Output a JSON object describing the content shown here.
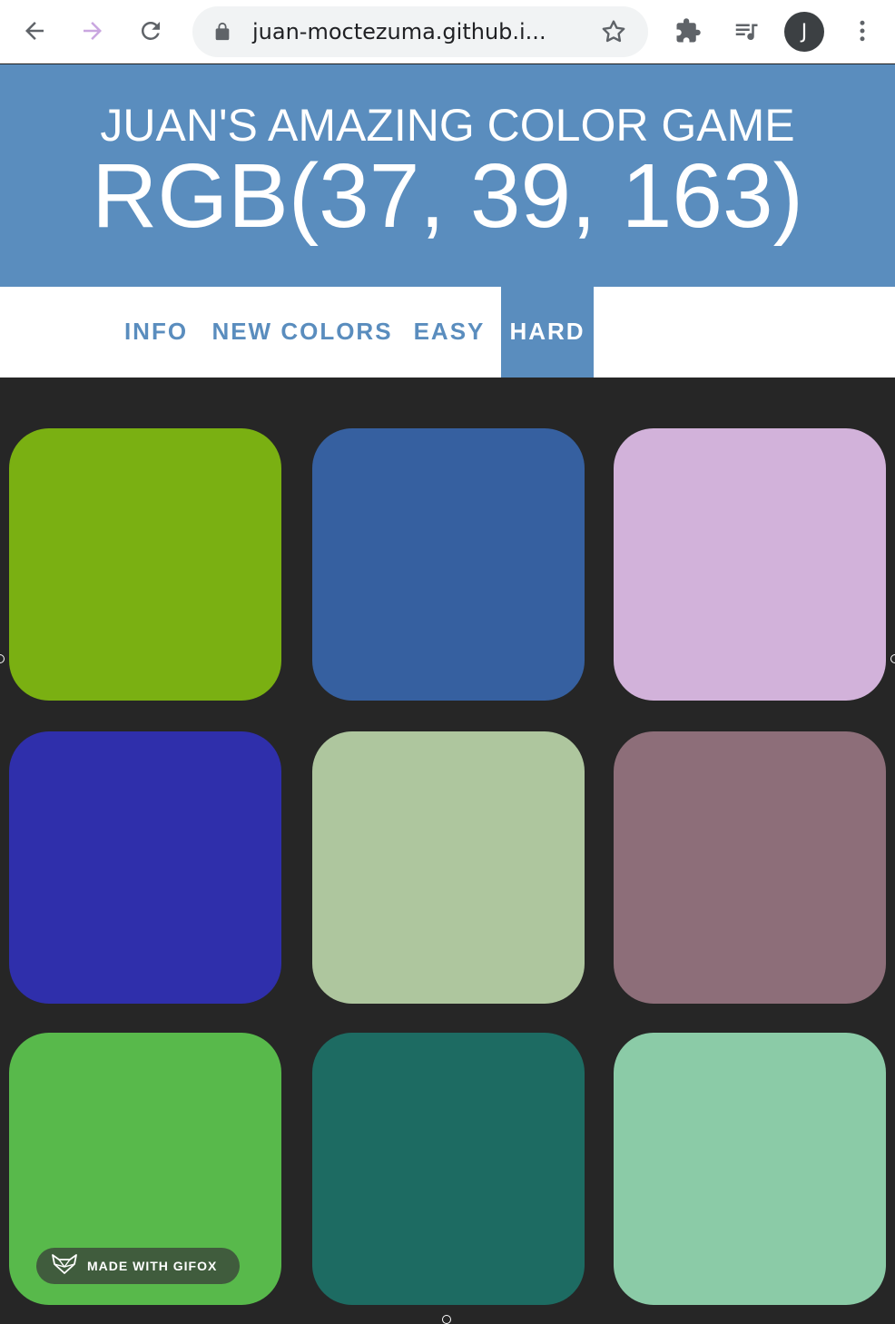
{
  "browser": {
    "url": "juan-moctezuma.github.i...",
    "avatar_letter": "J",
    "icons": [
      "back-arrow-icon",
      "forward-arrow-icon",
      "reload-icon",
      "lock-icon",
      "star-icon",
      "puzzle-icon",
      "media-queue-icon",
      "kebab-menu-icon"
    ]
  },
  "header": {
    "title": "JUAN'S AMAZING COLOR GAME",
    "target_rgb": "RGB(37, 39, 163)",
    "background": "#5a8dbe"
  },
  "menu": {
    "items": [
      {
        "label": "INFO",
        "selected": false
      },
      {
        "label": "NEW COLORS",
        "selected": false
      },
      {
        "label": "EASY",
        "selected": false
      },
      {
        "label": "HARD",
        "selected": true
      }
    ]
  },
  "board": {
    "squares": [
      {
        "color": "#7ab012"
      },
      {
        "color": "#3660a0"
      },
      {
        "color": "#d2b2da"
      },
      {
        "color": "#2f2fab"
      },
      {
        "color": "#aec69e"
      },
      {
        "color": "#8d6e79"
      },
      {
        "color": "#58b94b"
      },
      {
        "color": "#1d6b62"
      },
      {
        "color": "#8bcba7"
      }
    ]
  },
  "watermark": {
    "text": "MADE WITH GIFOX"
  }
}
